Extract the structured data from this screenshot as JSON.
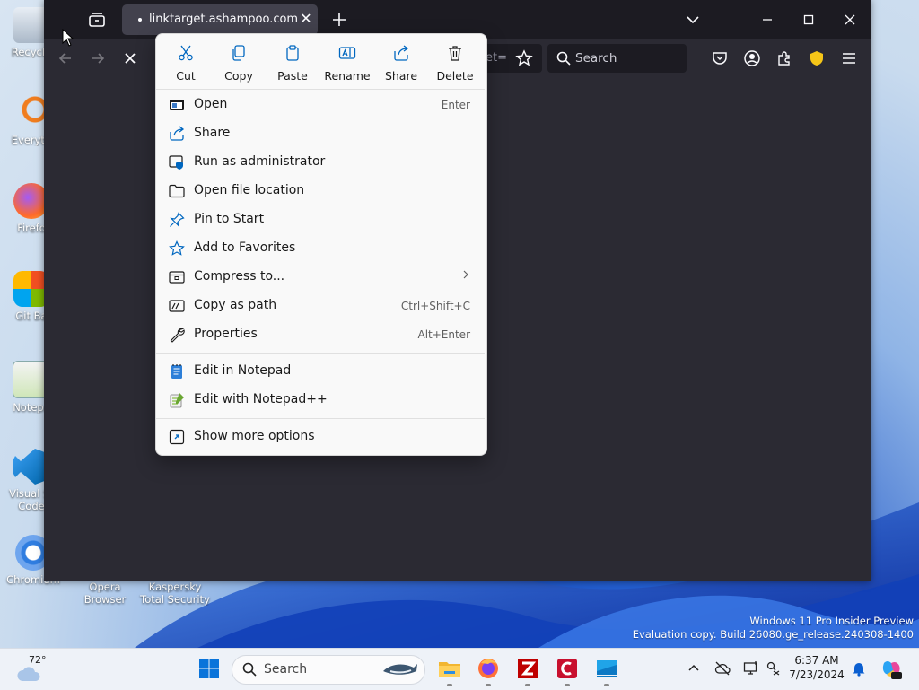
{
  "desktop": {
    "icons": [
      {
        "label": "Recycle"
      },
      {
        "label": "Everyth"
      },
      {
        "label": "Firefo"
      },
      {
        "label": "Git Ba"
      },
      {
        "label": "Notepa"
      },
      {
        "label": "Visual St",
        "label2": "Code"
      },
      {
        "label": "Chromium"
      },
      {
        "label": "Opera",
        "label2": "Browser"
      },
      {
        "label": "Kaspersky",
        "label2": "Total Security"
      }
    ],
    "watermark": {
      "line1": "Windows 11 Pro Insider Preview",
      "line2": "Evaluation copy. Build 26080.ge_release.240308-1400"
    }
  },
  "browser": {
    "tab": {
      "title": "linktarget.ashampoo.com/linkt",
      "close_glyph": "✕"
    },
    "url_tail": "et=",
    "search_placeholder": "Search"
  },
  "context_menu": {
    "quick_actions": [
      {
        "label": "Cut",
        "icon": "scissors-icon"
      },
      {
        "label": "Copy",
        "icon": "copy-icon"
      },
      {
        "label": "Paste",
        "icon": "paste-icon"
      },
      {
        "label": "Rename",
        "icon": "rename-icon"
      },
      {
        "label": "Share",
        "icon": "share-icon"
      },
      {
        "label": "Delete",
        "icon": "trash-icon"
      }
    ],
    "items": [
      {
        "label": "Open",
        "shortcut": "Enter",
        "icon": "open-app-icon"
      },
      {
        "label": "Share",
        "shortcut": "",
        "icon": "share-icon"
      },
      {
        "label": "Run as administrator",
        "shortcut": "",
        "icon": "shield-admin-icon"
      },
      {
        "label": "Open file location",
        "shortcut": "",
        "icon": "folder-icon"
      },
      {
        "label": "Pin to Start",
        "shortcut": "",
        "icon": "pin-icon"
      },
      {
        "label": "Add to Favorites",
        "shortcut": "",
        "icon": "star-icon"
      },
      {
        "label": "Compress to...",
        "shortcut": "",
        "icon": "archive-icon",
        "submenu": true
      },
      {
        "label": "Copy as path",
        "shortcut": "Ctrl+Shift+C",
        "icon": "path-icon"
      },
      {
        "label": "Properties",
        "shortcut": "Alt+Enter",
        "icon": "wrench-icon"
      },
      {
        "label": "Edit in Notepad",
        "shortcut": "",
        "icon": "notepad-icon"
      },
      {
        "label": "Edit with Notepad++",
        "shortcut": "",
        "icon": "notepadpp-icon"
      },
      {
        "label": "Show more options",
        "shortcut": "",
        "icon": "more-options-icon"
      }
    ]
  },
  "taskbar": {
    "weather_temp": "72°",
    "search_placeholder": "Search",
    "time": "6:37 AM",
    "date": "7/23/2024"
  },
  "colors": {
    "browser_bg": "#1c1b22",
    "menu_bg": "#f9f9f9",
    "accent": "#0067c0"
  }
}
